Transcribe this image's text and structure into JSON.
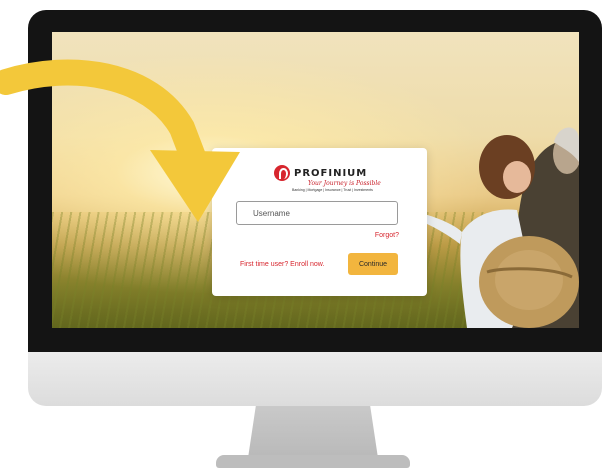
{
  "brand": {
    "name": "PROFINIUM",
    "tagline": "Your Journey is Possible",
    "sub_tagline": "Banking | Mortgage | Insurance | Trust | Investments",
    "accent_color": "#d7262e"
  },
  "login": {
    "username_placeholder": "Username",
    "username_value": "",
    "forgot_label": "Forgot?",
    "enroll_label": "First time user? Enroll now.",
    "continue_label": "Continue",
    "continue_color": "#f2b53e"
  },
  "icons": {
    "logo": "profinium-logo-icon",
    "arrow": "curved-arrow-icon"
  }
}
